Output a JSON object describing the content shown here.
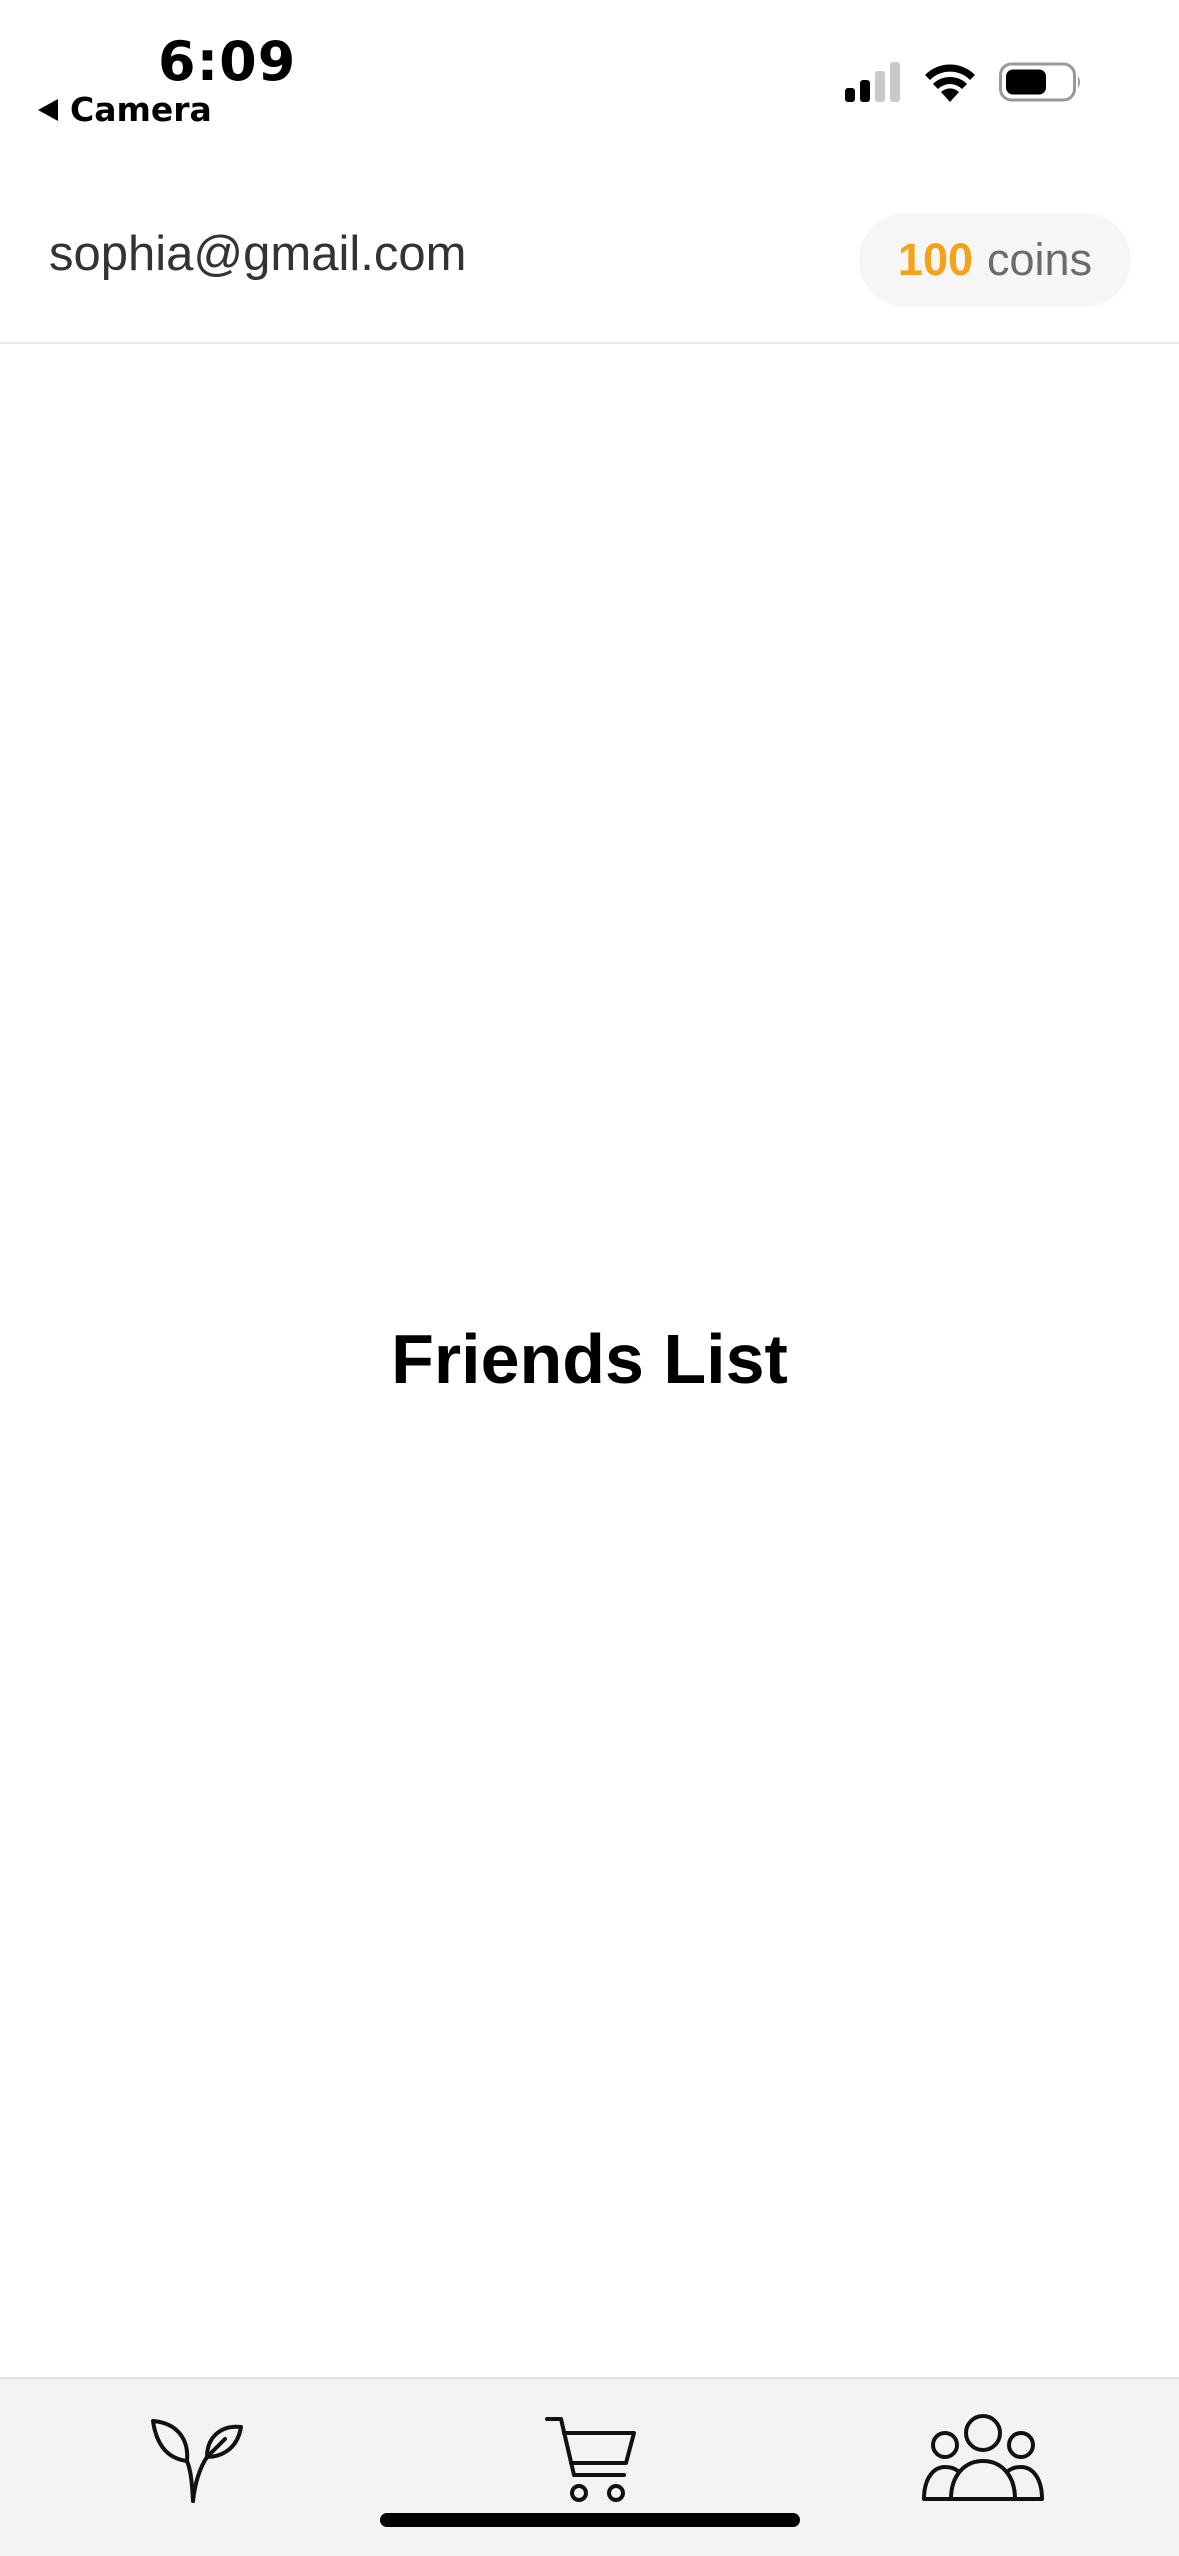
{
  "status_bar": {
    "time": "6:09",
    "back_label": "Camera"
  },
  "header": {
    "email": "sophia@gmail.com",
    "coins_amount": "100",
    "coins_unit": "coins"
  },
  "main": {
    "title": "Friends List"
  },
  "tab_bar": {
    "items": [
      {
        "icon": "sprout-icon"
      },
      {
        "icon": "shopping-cart-icon"
      },
      {
        "icon": "users-icon"
      }
    ]
  },
  "colors": {
    "coins_accent": "#f5a21b",
    "tab_bar_bg": "#f3f3f3"
  }
}
